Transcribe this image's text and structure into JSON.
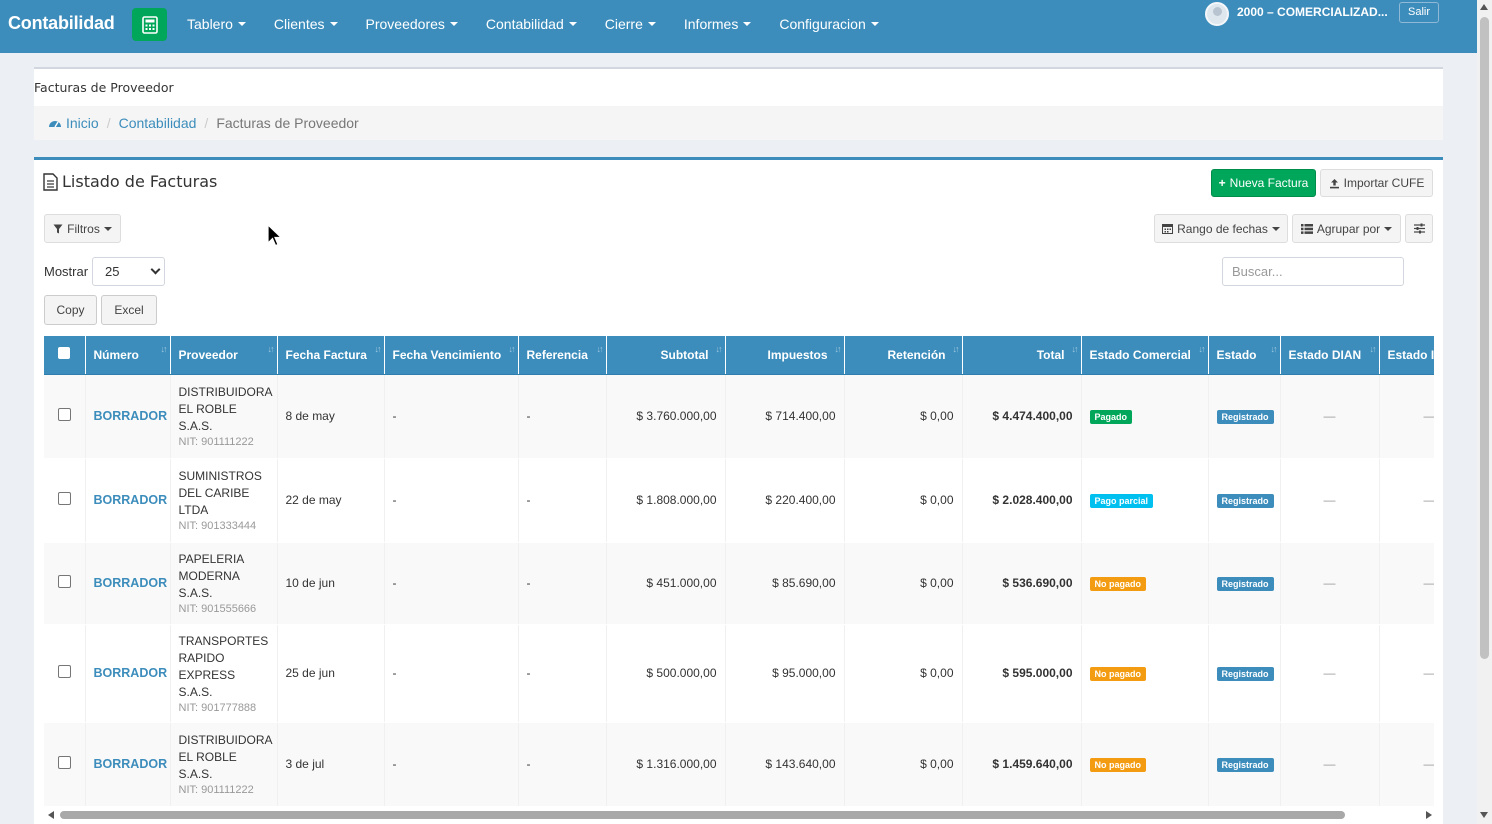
{
  "navbar": {
    "brand": "Contabilidad",
    "brand_icon": "calculator-icon",
    "items": [
      {
        "label": "Tablero"
      },
      {
        "label": "Clientes"
      },
      {
        "label": "Proveedores"
      },
      {
        "label": "Contabilidad"
      },
      {
        "label": "Cierre"
      },
      {
        "label": "Informes"
      },
      {
        "label": "Configuracion"
      }
    ],
    "user": "2000 – COMERCIALIZAD...",
    "logout": "Salir"
  },
  "header": {
    "title": "Facturas de Proveedor",
    "breadcrumb": {
      "home": "Inicio",
      "section": "Contabilidad",
      "current": "Facturas de Proveedor"
    }
  },
  "box": {
    "title": "Listado de Facturas",
    "new_button": "Nueva Factura",
    "import_button": "Importar CUFE",
    "filters_button": "Filtros",
    "date_range_button": "Rango de fechas",
    "group_by_button": "Agrupar por",
    "show_label": "Mostrar",
    "show_value": "25",
    "copy_button": "Copy",
    "excel_button": "Excel",
    "search_placeholder": "Buscar..."
  },
  "table": {
    "columns": [
      "Número",
      "Proveedor",
      "Fecha Factura",
      "Fecha Vencimiento",
      "Referencia",
      "Subtotal",
      "Impuestos",
      "Retención",
      "Total",
      "Estado Comercial",
      "Estado",
      "Estado DIAN",
      "Estado I"
    ],
    "rows": [
      {
        "numero": "BORRADOR",
        "proveedor": "DISTRIBUIDORA EL ROBLE S.A.S.",
        "nit": "NIT: 901111222",
        "fecha": "8 de may",
        "vencimiento": "-",
        "referencia": "-",
        "subtotal": "$ 3.760.000,00",
        "impuestos": "$ 714.400,00",
        "retencion": "$ 0,00",
        "total": "$ 4.474.400,00",
        "estado_comercial": "Pagado",
        "estado_comercial_color": "#00a65a",
        "estado": "Registrado",
        "estado_dian": "—",
        "estado_extra": "—"
      },
      {
        "numero": "BORRADOR",
        "proveedor": "SUMINISTROS DEL CARIBE LTDA",
        "nit": "NIT: 901333444",
        "fecha": "22 de may",
        "vencimiento": "-",
        "referencia": "-",
        "subtotal": "$ 1.808.000,00",
        "impuestos": "$ 220.400,00",
        "retencion": "$ 0,00",
        "total": "$ 2.028.400,00",
        "estado_comercial": "Pago parcial",
        "estado_comercial_color": "#00c0ef",
        "estado": "Registrado",
        "estado_dian": "—",
        "estado_extra": "—"
      },
      {
        "numero": "BORRADOR",
        "proveedor": "PAPELERIA MODERNA S.A.S.",
        "nit": "NIT: 901555666",
        "fecha": "10 de jun",
        "vencimiento": "-",
        "referencia": "-",
        "subtotal": "$ 451.000,00",
        "impuestos": "$ 85.690,00",
        "retencion": "$ 0,00",
        "total": "$ 536.690,00",
        "estado_comercial": "No pagado",
        "estado_comercial_color": "#f39c12",
        "estado": "Registrado",
        "estado_dian": "—",
        "estado_extra": "—"
      },
      {
        "numero": "BORRADOR",
        "proveedor": "TRANSPORTES RAPIDO EXPRESS S.A.S.",
        "nit": "NIT: 901777888",
        "fecha": "25 de jun",
        "vencimiento": "-",
        "referencia": "-",
        "subtotal": "$ 500.000,00",
        "impuestos": "$ 95.000,00",
        "retencion": "$ 0,00",
        "total": "$ 595.000,00",
        "estado_comercial": "No pagado",
        "estado_comercial_color": "#f39c12",
        "estado": "Registrado",
        "estado_dian": "—",
        "estado_extra": "—"
      },
      {
        "numero": "BORRADOR",
        "proveedor": "DISTRIBUIDORA EL ROBLE S.A.S.",
        "nit": "NIT: 901111222",
        "fecha": "3 de jul",
        "vencimiento": "-",
        "referencia": "-",
        "subtotal": "$ 1.316.000,00",
        "impuestos": "$ 143.640,00",
        "retencion": "$ 0,00",
        "total": "$ 1.459.640,00",
        "estado_comercial": "No pagado",
        "estado_comercial_color": "#f39c12",
        "estado": "Registrado",
        "estado_dian": "—",
        "estado_extra": "—"
      }
    ]
  },
  "colors": {
    "primary": "#3c8dbc",
    "success": "#00a65a",
    "registrado": "#3c8dbc"
  }
}
